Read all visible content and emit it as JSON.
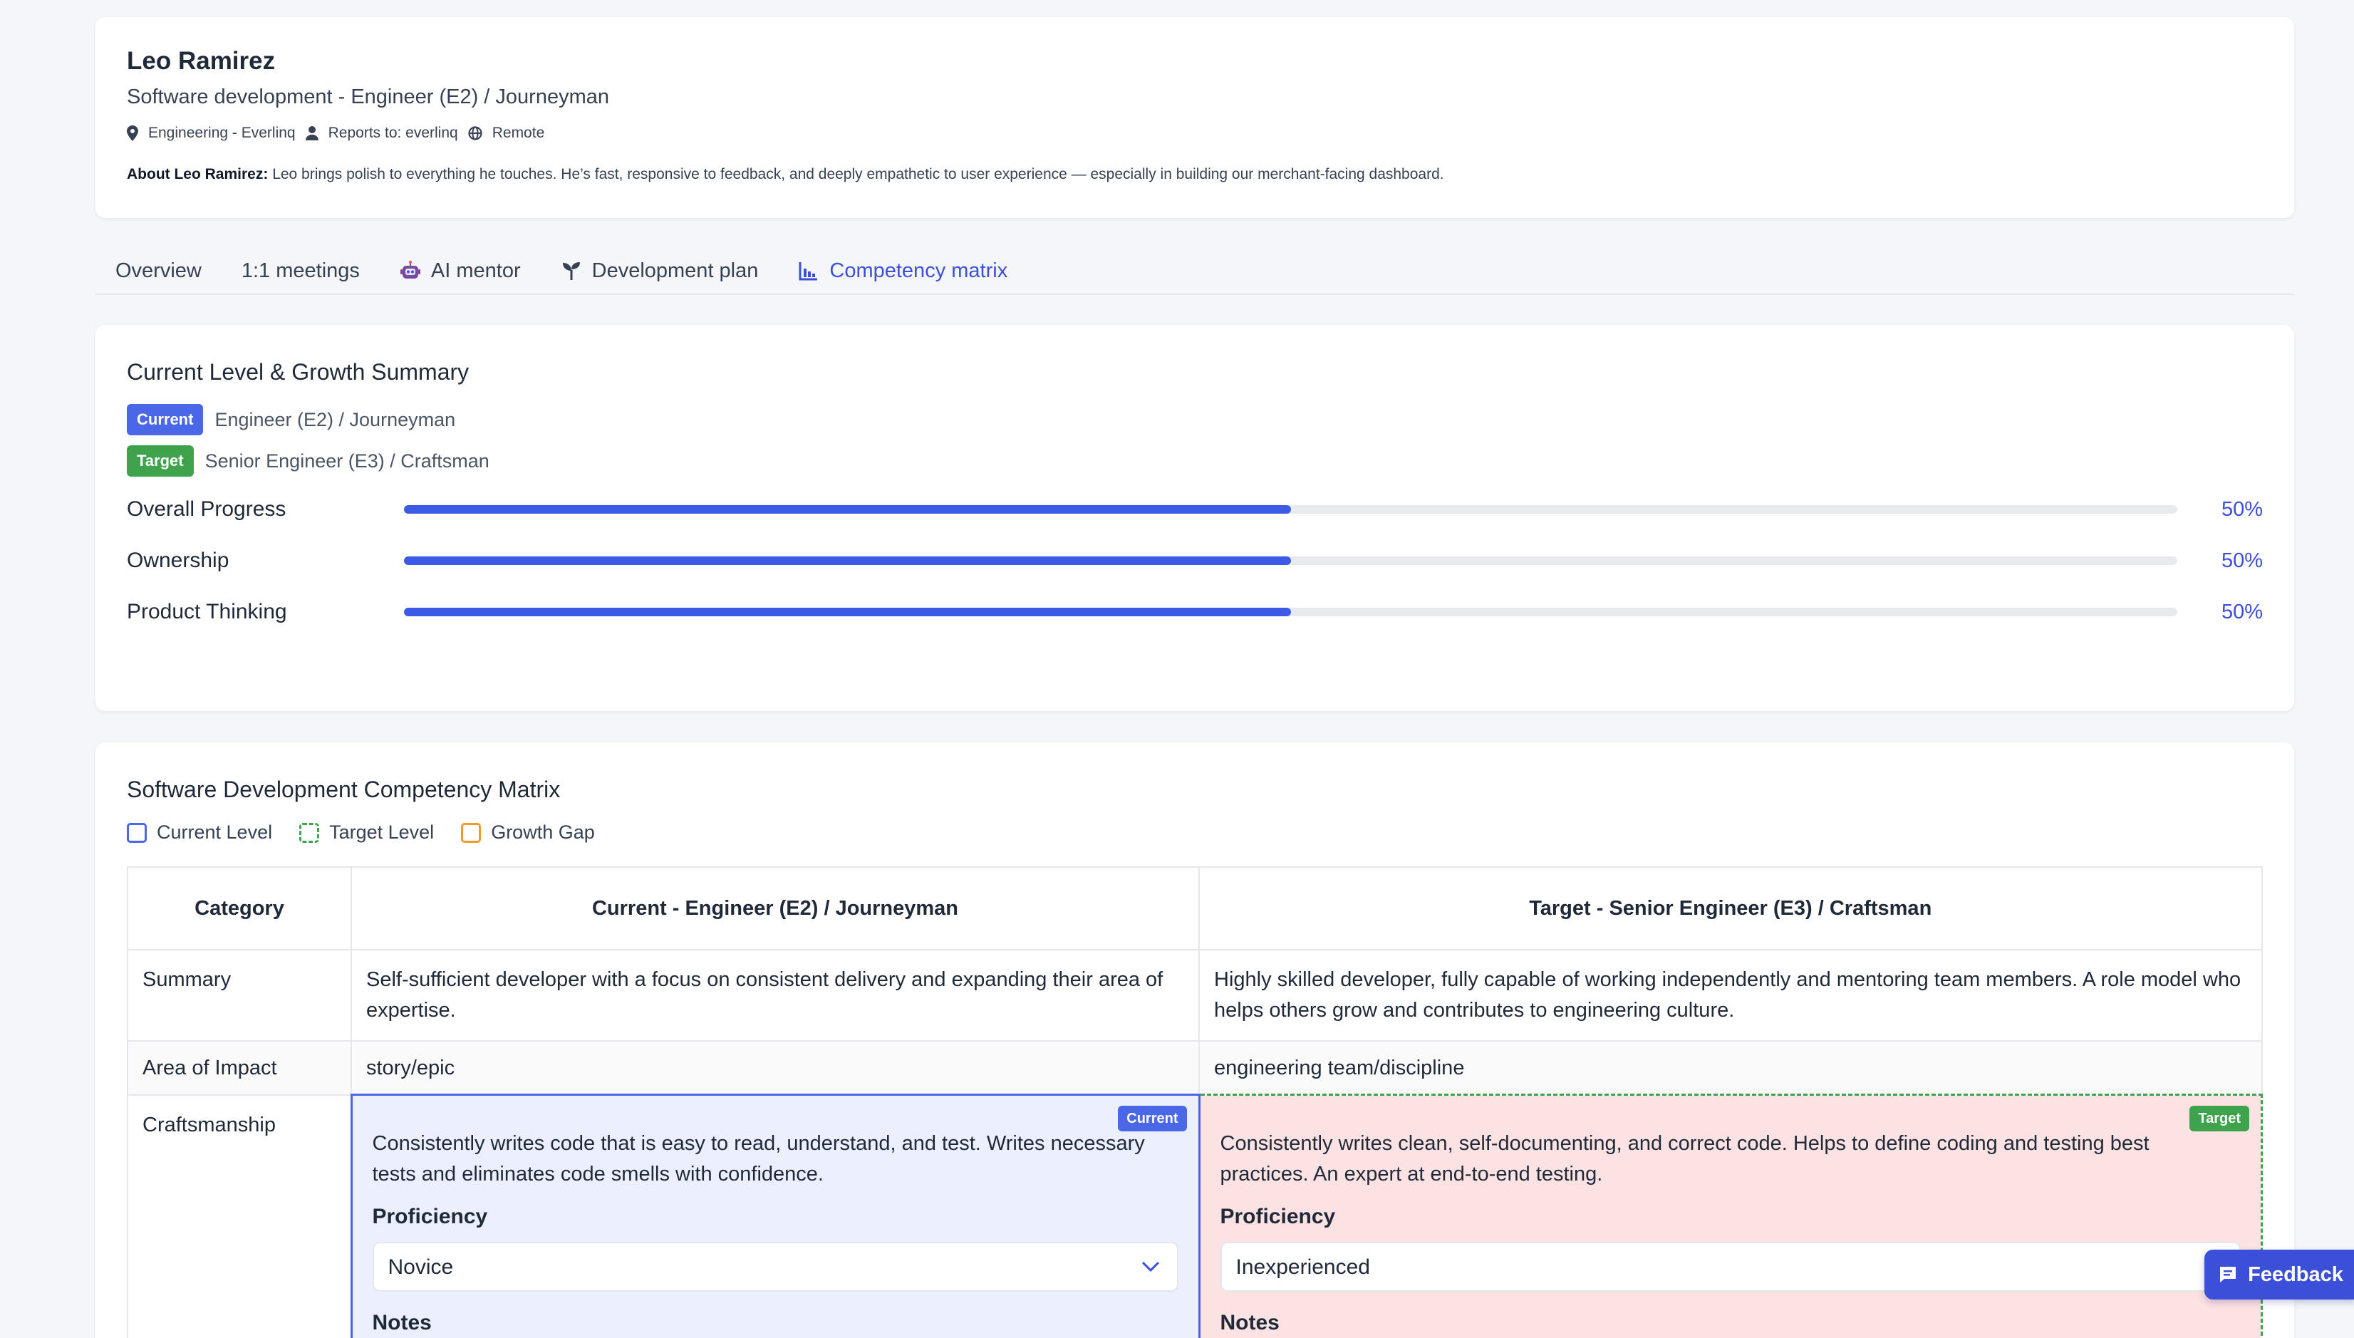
{
  "profile": {
    "name": "Leo Ramirez",
    "role": "Software development - Engineer (E2) / Journeyman",
    "department": "Engineering - Everlinq",
    "reports_to": "Reports to: everlinq",
    "location": "Remote",
    "about_label": "About Leo Ramirez:",
    "about_text": "Leo brings polish to everything he touches. He’s fast, responsive to feedback, and deeply empathetic to user experience — especially in building our merchant-facing dashboard."
  },
  "tabs": [
    {
      "label": "Overview",
      "icon": ""
    },
    {
      "label": "1:1 meetings",
      "icon": ""
    },
    {
      "label": "AI mentor",
      "icon": "robot-icon"
    },
    {
      "label": "Development plan",
      "icon": "sprout-icon"
    },
    {
      "label": "Competency matrix",
      "icon": "bar-chart-icon",
      "active": true
    }
  ],
  "summary": {
    "title": "Current Level & Growth Summary",
    "current_badge": "Current",
    "current_level": "Engineer (E2) / Journeyman",
    "target_badge": "Target",
    "target_level": "Senior Engineer (E3) / Craftsman",
    "progress": [
      {
        "label": "Overall Progress",
        "value_text": "50%",
        "fraction": 0.5
      },
      {
        "label": "Ownership",
        "value_text": "50%",
        "fraction": 0.5
      },
      {
        "label": "Product Thinking",
        "value_text": "50%",
        "fraction": 0.5
      }
    ]
  },
  "matrix": {
    "title": "Software Development Competency Matrix",
    "legend": {
      "current": "Current Level",
      "target": "Target Level",
      "gap": "Growth Gap"
    },
    "headers": {
      "category": "Category",
      "current": "Current - Engineer (E2) / Journeyman",
      "target": "Target - Senior Engineer (E3) / Craftsman"
    },
    "rows": {
      "summary": {
        "category": "Summary",
        "current": "Self-sufficient developer with a focus on consistent delivery and expanding their area of expertise.",
        "target": "Highly skilled developer, fully capable of working independently and mentoring team members. A role model who helps others grow and contributes to engineering culture."
      },
      "impact": {
        "category": "Area of Impact",
        "current": "story/epic",
        "target": "engineering team/discipline"
      },
      "craftsmanship": {
        "category": "Craftsmanship",
        "current_badge": "Current",
        "target_badge": "Target",
        "current": "Consistently writes code that is easy to read, understand, and test. Writes necessary tests and eliminates code smells with confidence.",
        "target": "Consistently writes clean, self-documenting, and correct code. Helps to define coding and testing best practices. An expert at end-to-end testing.",
        "proficiency_label": "Proficiency",
        "current_proficiency": "Novice",
        "target_proficiency": "Inexperienced",
        "notes_label": "Notes"
      }
    }
  },
  "feedback_button": "Feedback",
  "colors": {
    "accent": "#3b4fd8",
    "progress": "#3b5be6",
    "current": "#4a67e8",
    "target": "#3fa34d",
    "gap": "#f29b2a",
    "target_cell_bg": "#fde2e3",
    "current_cell_bg": "#eceffd"
  }
}
